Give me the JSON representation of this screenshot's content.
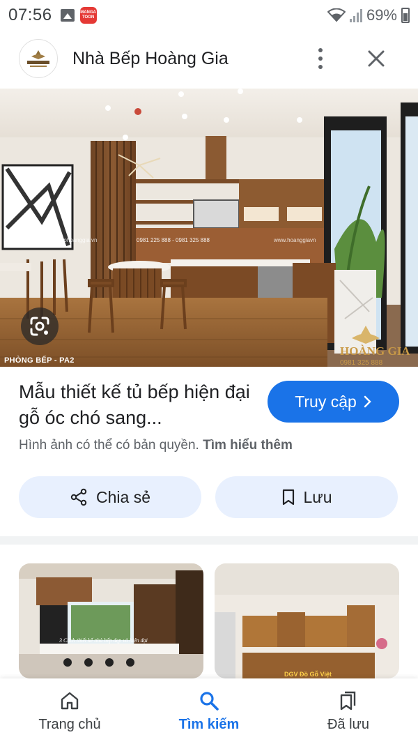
{
  "status_bar": {
    "time": "07:56",
    "notification_app_label": "MANGA TOON",
    "battery_percent": "69%",
    "icons": [
      "gallery-icon",
      "mangatoon-app-icon",
      "wifi-icon",
      "signal-icon",
      "battery-icon"
    ]
  },
  "header": {
    "site_name": "Nhà Bếp Hoàng Gia",
    "logo_text": "HOÀNG GIA",
    "icons": [
      "more-vert-icon",
      "close-icon"
    ]
  },
  "hero": {
    "caption": "PHÒNG BẾP - PA2",
    "watermark_site": "www.nhabephoanggia.vn",
    "watermark_phones": "0981 225 888 - 0981 325 888",
    "watermark_site_2": "www.hoanggiavn",
    "brand_mark": "HOÀNG GIA",
    "brand_phone": "0981 325 888",
    "lens_icon": "google-lens-icon"
  },
  "result": {
    "title": "Mẫu thiết kế tủ bếp hiện đại gỗ óc chó sang...",
    "visit_label": "Truy cập",
    "copyright_text": "Hình ảnh có thể có bản quyền.",
    "learn_more": "Tìm hiểu thêm"
  },
  "actions": {
    "share_label": "Chia sẻ",
    "save_label": "Lưu"
  },
  "related": [
    {
      "overlay_text": "3 Cách thiết kế nhà bếp đẹp và hiện đại"
    },
    {
      "overlay_text": "DGV Đồ Gỗ Việt"
    }
  ],
  "bottom_nav": {
    "items": [
      {
        "label": "Trang chủ",
        "icon": "home-icon",
        "active": false
      },
      {
        "label": "Tìm kiếm",
        "icon": "search-icon",
        "active": true
      },
      {
        "label": "Đã lưu",
        "icon": "saved-collections-icon",
        "active": false
      }
    ]
  },
  "colors": {
    "accent": "#1a73e8",
    "tonal_button": "#e8f0fe",
    "text_primary": "#202124",
    "text_secondary": "#5f6368"
  }
}
